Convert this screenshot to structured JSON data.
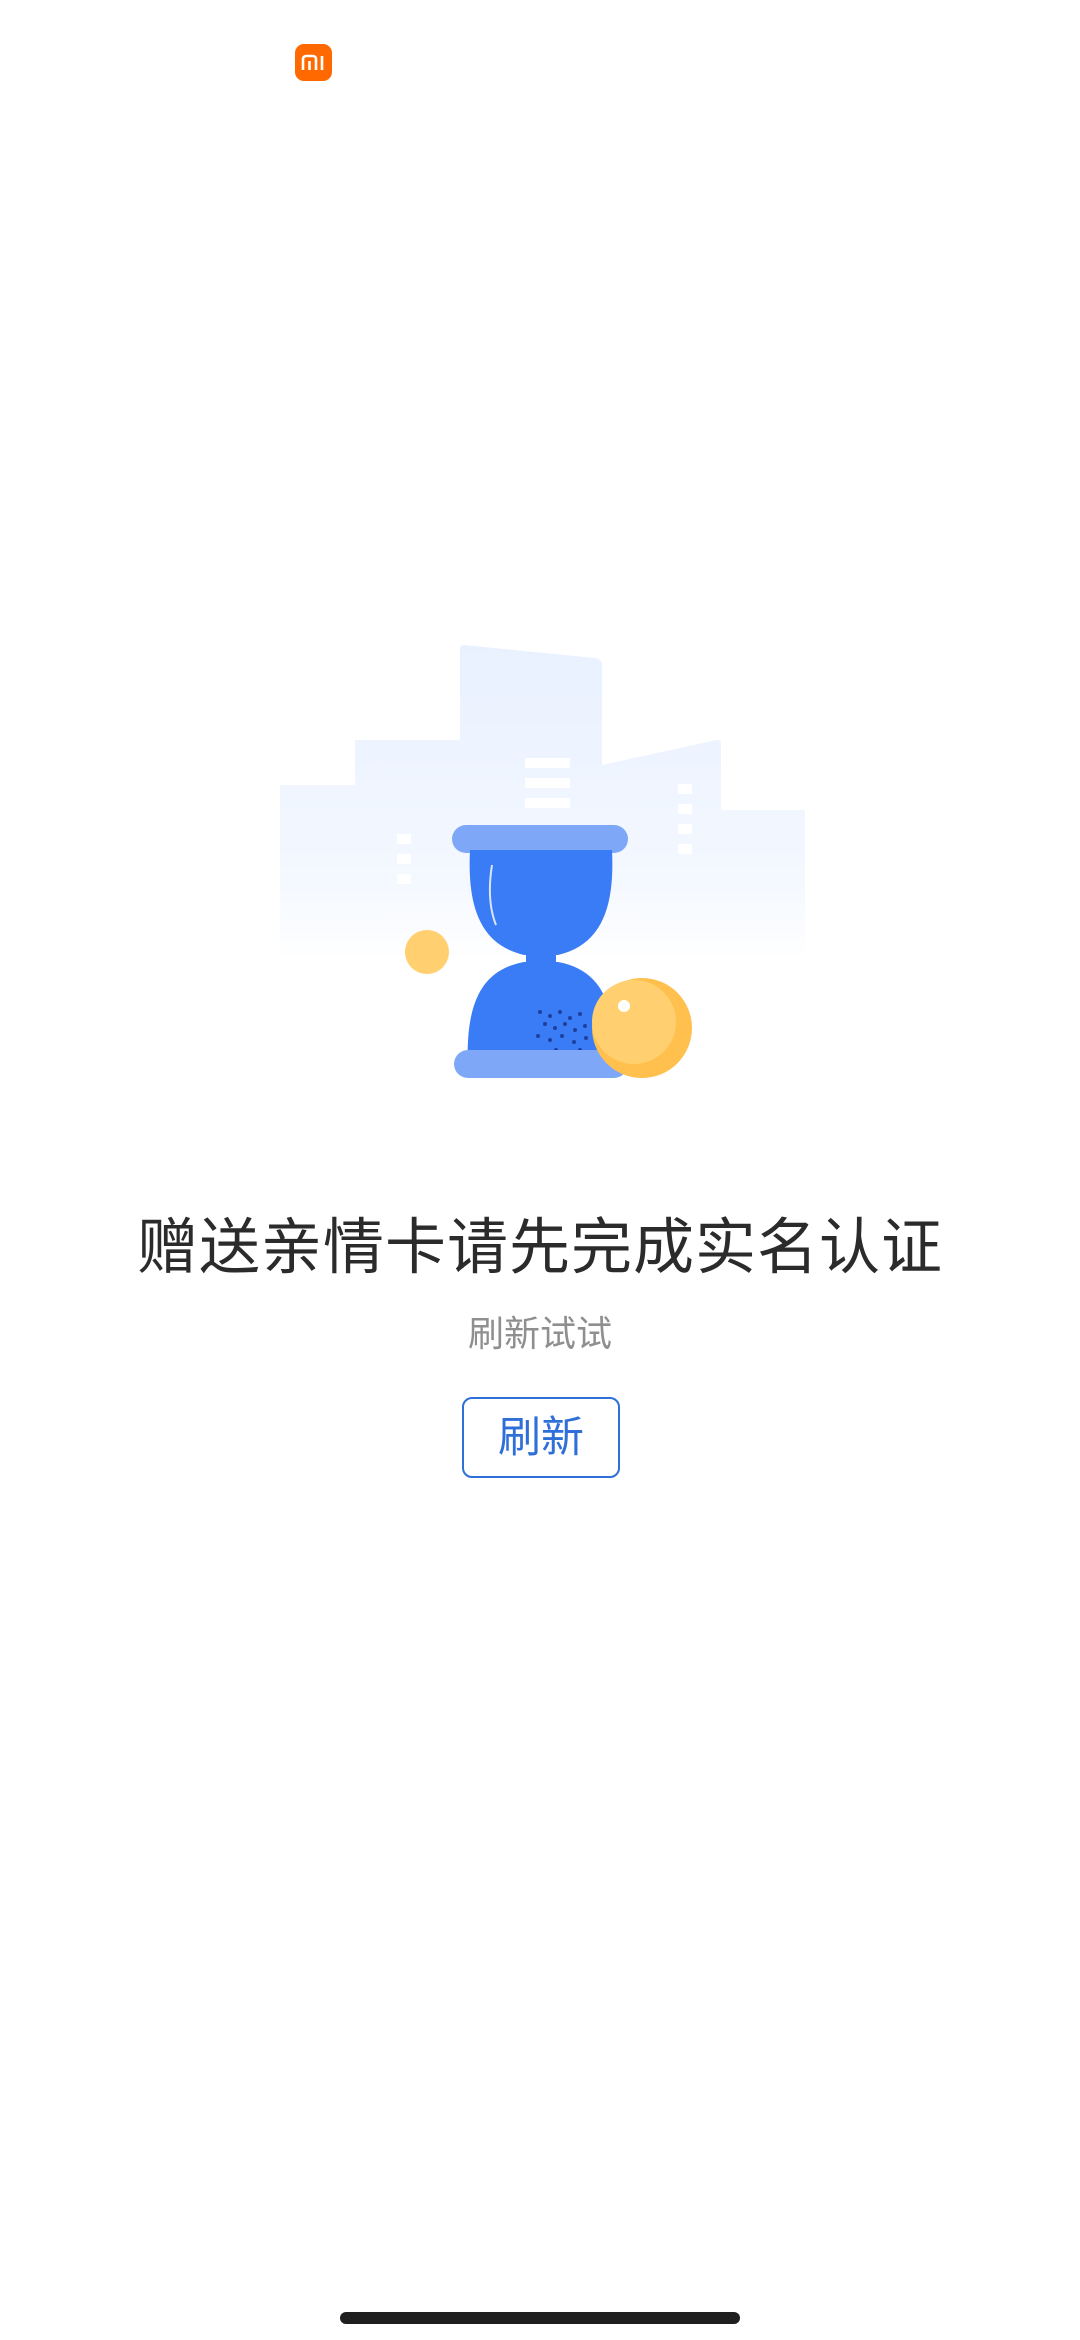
{
  "status_bar": {
    "app_icon": "mi-logo-icon",
    "brand_color": "#ff6900"
  },
  "illustration": {
    "icon": "hourglass-icon",
    "accent": "#3a7cf6",
    "coin_color": "#ffc85a"
  },
  "message": {
    "title": "赠送亲情卡请先完成实名认证",
    "subtitle": "刷新试试"
  },
  "actions": {
    "refresh_label": "刷新",
    "accent": "#2f6fd8"
  }
}
